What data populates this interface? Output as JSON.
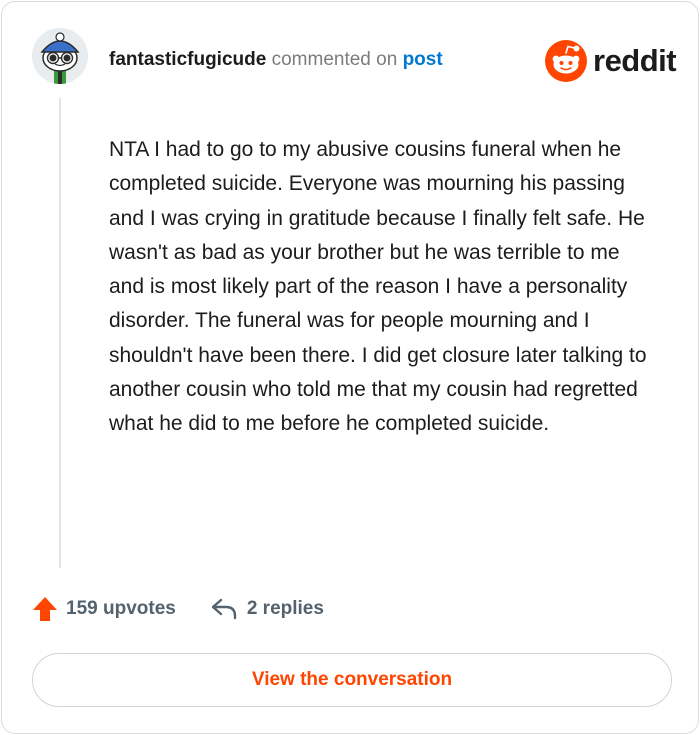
{
  "header": {
    "username": "fantasticfugicude",
    "action_text": "commented on",
    "post_link": "post"
  },
  "brand": {
    "wordmark": "reddit",
    "icon": "reddit-snoo-logo-icon",
    "brand_color": "#ff4500"
  },
  "comment": {
    "body": "NTA I had to go to my abusive cousins funeral when he completed suicide. Everyone was mourning his passing and I was crying in gratitude because I finally felt safe. He wasn't as bad as your brother but he was terrible to me and is most likely part of the reason I have a personality disorder. The funeral was for people mourning and I shouldn't have been there. I did get closure later talking to another cousin who told me that my cousin had regretted what he did to me before he completed suicide."
  },
  "actions": {
    "upvotes_label": "159 upvotes",
    "replies_label": "2 replies",
    "upvote_icon": "upvote-arrow-icon",
    "reply_icon": "reply-arrow-icon"
  },
  "cta": {
    "view_conversation_label": "View the conversation"
  },
  "colors": {
    "accent": "#ff4500",
    "link": "#0079d3",
    "text": "#1c1c1c",
    "muted": "#7c7c7c"
  }
}
